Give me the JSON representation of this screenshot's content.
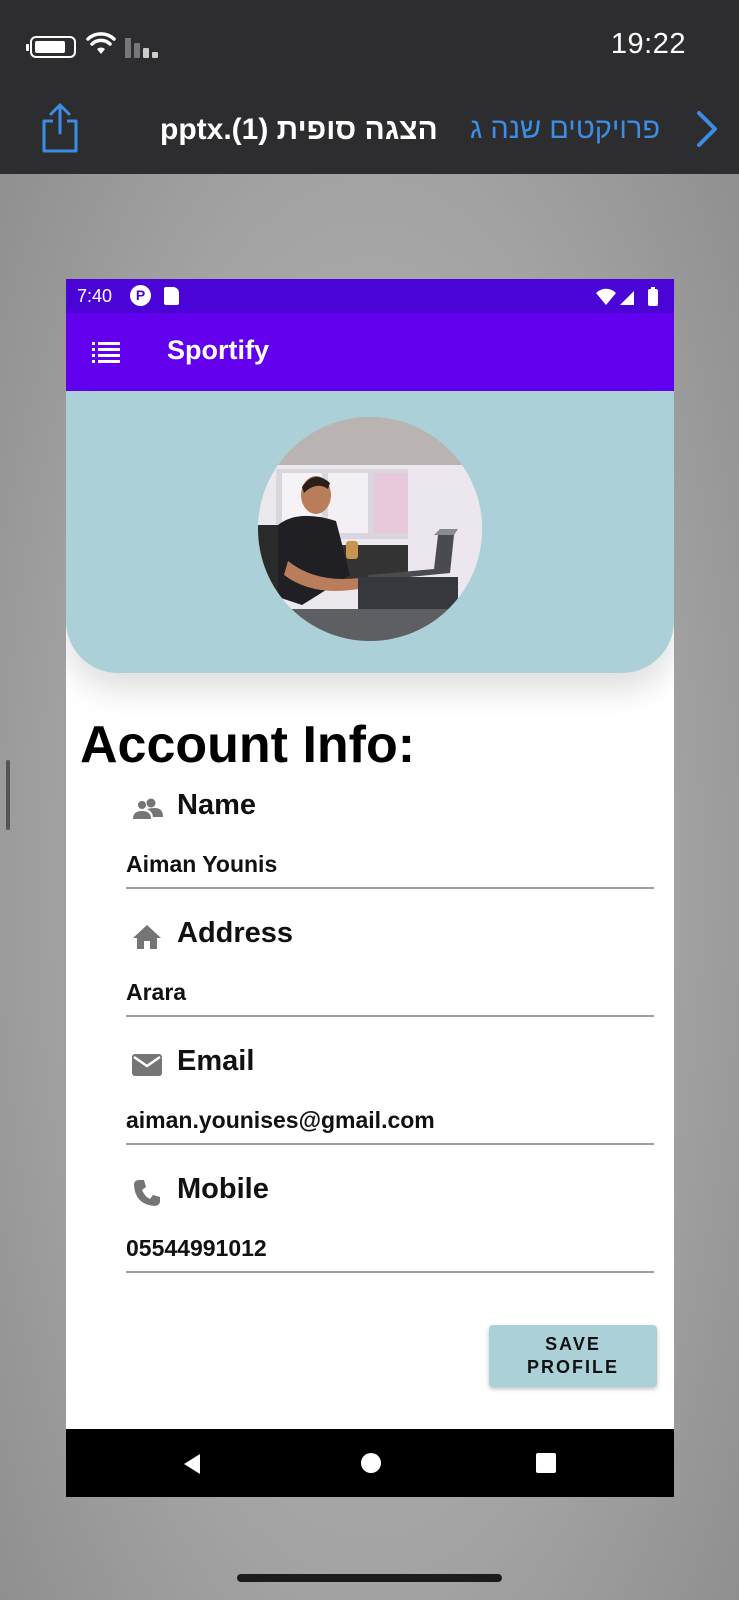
{
  "ios": {
    "time": "19:22",
    "nav_back_label": "פרויקטים שנה ג",
    "document_title": "pptx.(1) הצגה סופית"
  },
  "android": {
    "status_time": "7:40",
    "app_title": "Sportify"
  },
  "profile": {
    "section_title": "Account Info:",
    "fields": [
      {
        "label": "Name",
        "value": "Aiman Younis",
        "icon": "people-icon"
      },
      {
        "label": "Address",
        "value": "Arara",
        "icon": "home-icon"
      },
      {
        "label": "Email",
        "value": "aiman.younises@gmail.com",
        "icon": "email-icon"
      },
      {
        "label": "Mobile",
        "value": "05544991012",
        "icon": "phone-icon"
      }
    ],
    "save_button": "SAVE\nPROFILE"
  },
  "colors": {
    "status_bar": "#4b04d6",
    "app_bar": "#6200ee",
    "header_card": "#acd0d8",
    "ios_link": "#3a8ee6"
  }
}
